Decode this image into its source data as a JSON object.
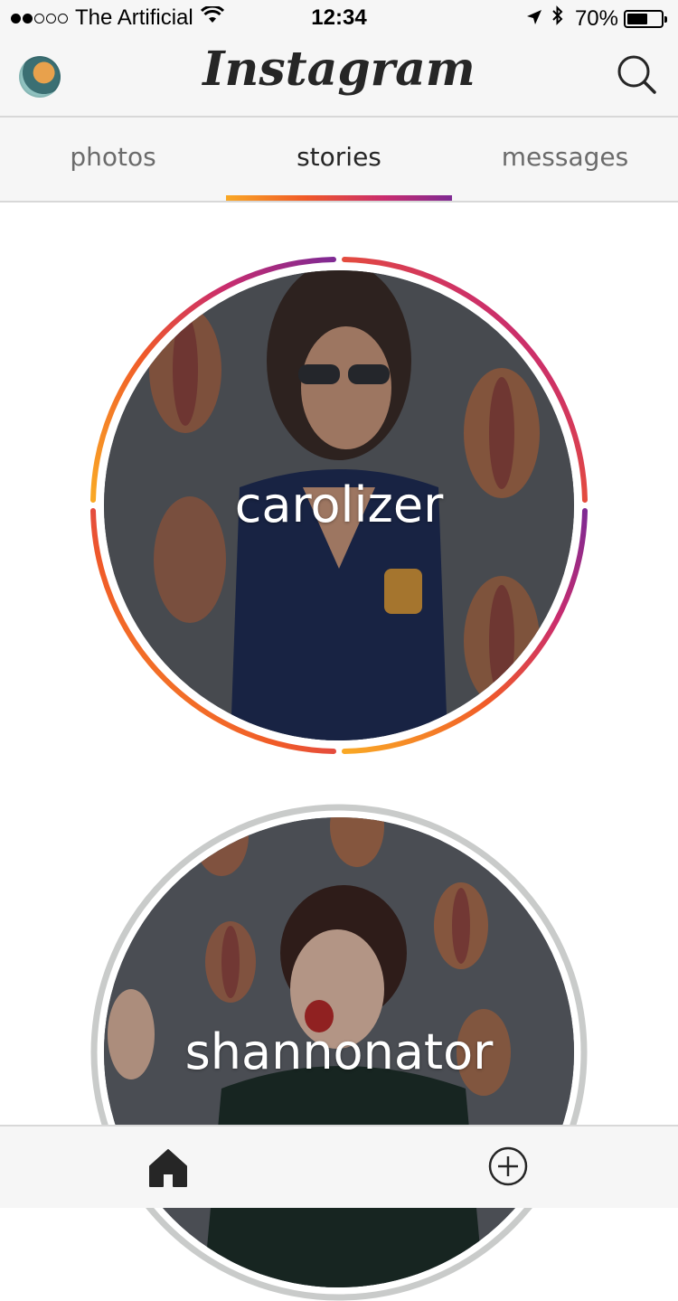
{
  "status_bar": {
    "carrier": "The Artificial",
    "time": "12:34",
    "battery_percent_label": "70%",
    "battery_level": 0.7,
    "signal_bars_filled": 2,
    "signal_bars_total": 5
  },
  "header": {
    "logo_text": "Instagram",
    "icons": {
      "avatar": "profile-avatar",
      "search": "search-icon"
    }
  },
  "tabs": [
    {
      "label": "photos",
      "active": false
    },
    {
      "label": "stories",
      "active": true
    },
    {
      "label": "messages",
      "active": false
    }
  ],
  "colors": {
    "gradient_start": "#f9a825",
    "gradient_mid1": "#f05a28",
    "gradient_mid2": "#c92c6e",
    "gradient_end": "#7f2a93",
    "seen_ring": "#c9cbca"
  },
  "stories": [
    {
      "username": "carolizer",
      "seen": false
    },
    {
      "username": "shannonator",
      "seen": true
    }
  ],
  "bottom_bar": {
    "icons": [
      "home-icon",
      "add-post-icon"
    ]
  }
}
